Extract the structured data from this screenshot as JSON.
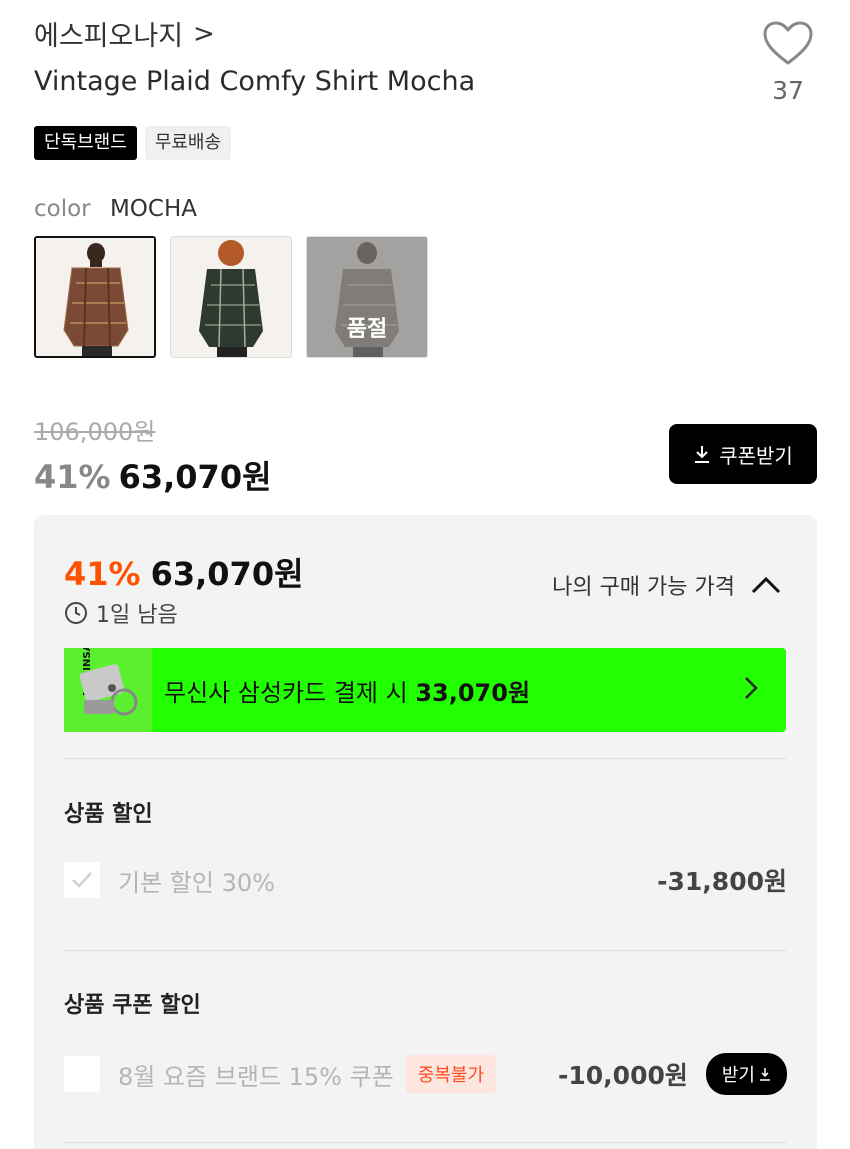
{
  "brand": {
    "name": "에스피오나지",
    "chevron": ">"
  },
  "product": {
    "title": "Vintage Plaid Comfy Shirt Mocha"
  },
  "like": {
    "count": "37",
    "icon": "heart-icon"
  },
  "badges": [
    {
      "label": "단독브랜드"
    },
    {
      "label": "무료배송"
    }
  ],
  "color": {
    "label": "color",
    "value": "MOCHA"
  },
  "swatches": [
    {
      "color_name": "mocha",
      "shirt_color": "#7a4a36",
      "sold_out": false
    },
    {
      "color_name": "green",
      "shirt_color": "#2e3a30",
      "sold_out": false
    },
    {
      "color_name": "grey",
      "shirt_color": "#6e6a66",
      "sold_out": true,
      "sold_out_label": "품절"
    }
  ],
  "price": {
    "original": "106,000원",
    "rate": "41%",
    "final": "63,070원"
  },
  "coupon_button": {
    "label": "쿠폰받기",
    "icon": "download-icon"
  },
  "panel": {
    "rate": "41%",
    "final": "63,070원",
    "remaining": "1일 남음",
    "my_price_label": "나의 구매 가능 가격",
    "card_banner": {
      "prefix": "무신사 삼성카드 결제 시",
      "amount": "33,070원",
      "background": "#22ff00"
    },
    "product_discount": {
      "title": "상품 할인",
      "item_label": "기본 할인 30%",
      "item_amount": "-31,800원"
    },
    "coupon_discount": {
      "title": "상품 쿠폰 할인",
      "item_label": "8월 요즘 브랜드 15% 쿠폰",
      "dup_badge": "중복불가",
      "item_amount": "-10,000원",
      "receive_label": "받기"
    }
  },
  "colors": {
    "accent": "#ff5200",
    "card_green": "#22ff00"
  }
}
